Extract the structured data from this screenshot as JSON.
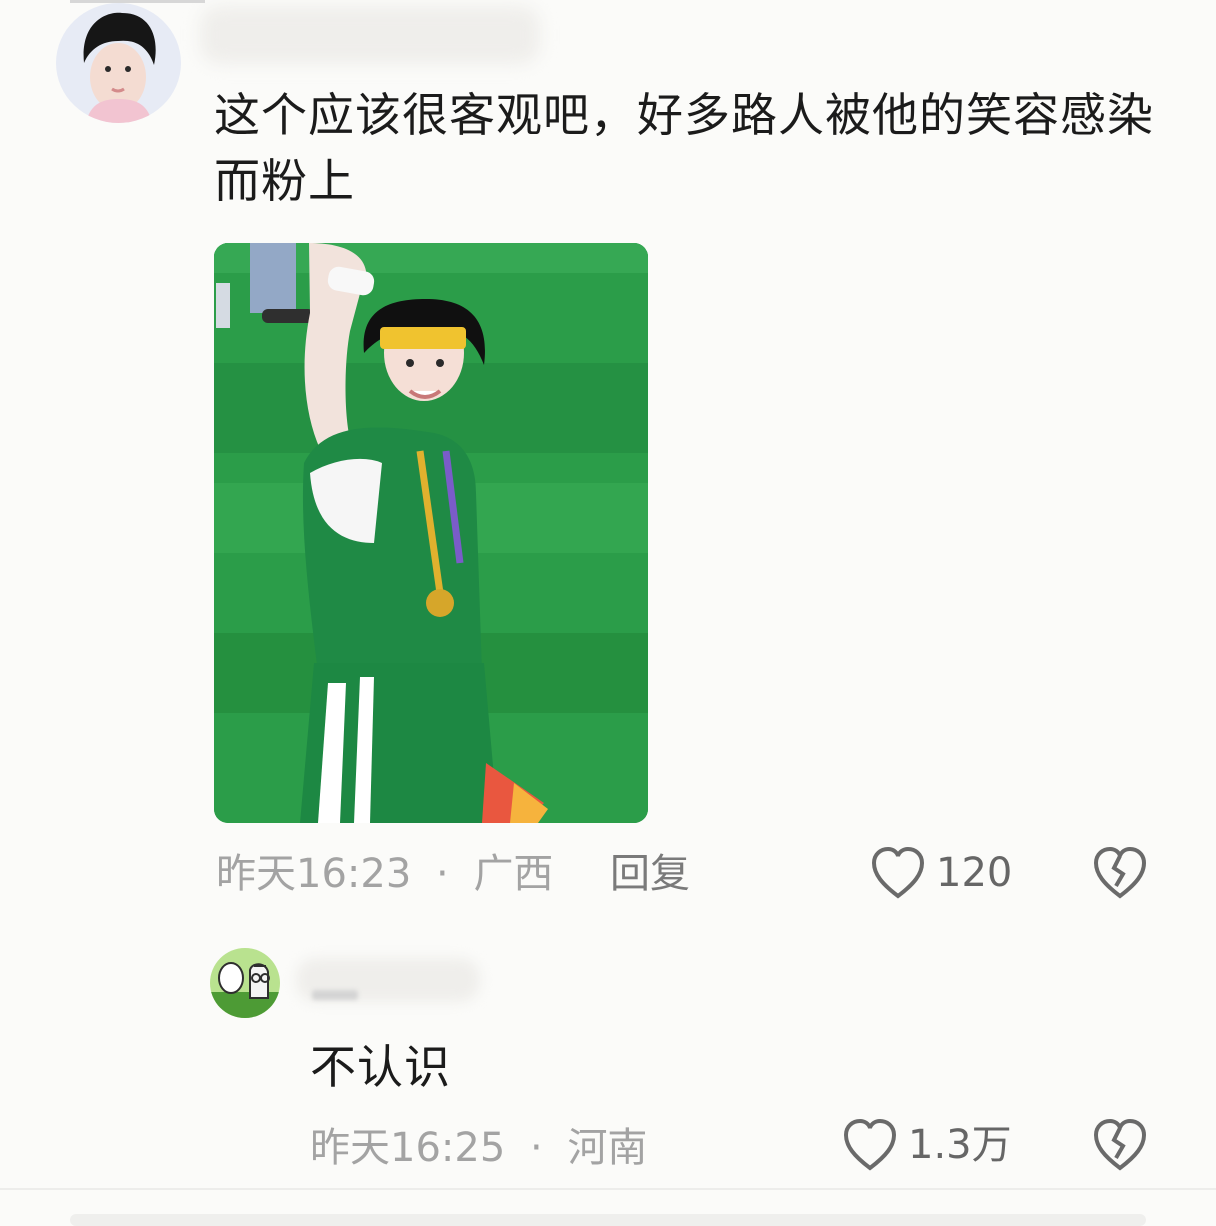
{
  "comments": [
    {
      "avatar_icon": "user-avatar",
      "text": "这个应该很客观吧，好多路人被他的笑容感染而粉上",
      "time": "昨天16:23",
      "separator": "·",
      "location": "广西",
      "reply_label": "回复",
      "like_count": "120",
      "like_icon": "heart-outline-icon",
      "dislike_icon": "broken-heart-icon"
    },
    {
      "avatar_icon": "cartoon-avatar",
      "text": "不认识",
      "time": "昨天16:25",
      "separator": "·",
      "location": "河南",
      "like_count": "1.3万",
      "like_icon": "heart-outline-icon",
      "dislike_icon": "broken-heart-icon"
    }
  ],
  "colors": {
    "background": "#fbfbf9",
    "text": "#1b1b1b",
    "meta": "#a3a3a3",
    "grass": "#2a9a4a",
    "jersey": "#1f8a45"
  }
}
